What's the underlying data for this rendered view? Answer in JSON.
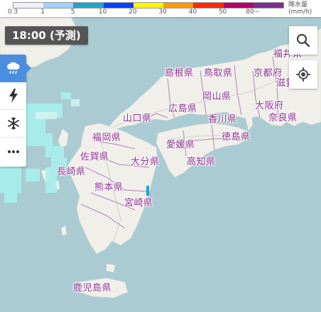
{
  "legend": {
    "unit_label": "降水量",
    "unit": "(mm/h)",
    "ticks": [
      "0.3",
      "1",
      "5",
      "10",
      "20",
      "30",
      "40",
      "50",
      "80~"
    ],
    "colors": [
      "#f2f2ff",
      "#a0d2ff",
      "#21a3c9",
      "#0041ff",
      "#fff500",
      "#ff9900",
      "#ff2800",
      "#b40068",
      "#7a2f8e"
    ]
  },
  "forecast_time": "18:00 (予測)",
  "layers": [
    {
      "name": "rain",
      "icon": "rain-cloud-icon",
      "active": true
    },
    {
      "name": "lightning",
      "icon": "lightning-icon",
      "active": false
    },
    {
      "name": "snow",
      "icon": "snowflake-icon",
      "active": false
    },
    {
      "name": "more",
      "icon": "more-icon",
      "active": false
    }
  ],
  "controls": {
    "search_icon": "search-icon",
    "locate_icon": "current-location-icon"
  },
  "prefectures": {
    "fukui": "福井県",
    "shimane": "島根県",
    "tottori": "鳥取県",
    "kyoto": "京都府",
    "shiga": "滋賀県",
    "okayama": "岡山県",
    "hiroshima": "広島県",
    "osaka": "大阪府",
    "yamaguchi": "山口県",
    "kagawa": "香川県",
    "nara": "奈良県",
    "fukuoka": "福岡県",
    "tokushima": "徳島県",
    "ehime": "愛媛県",
    "saga": "佐賀県",
    "oita": "大分県",
    "kochi": "高知県",
    "nagasaki": "長崎県",
    "kumamoto": "熊本県",
    "miyazaki": "宮崎県",
    "kagoshima": "鹿児島県"
  },
  "colors": {
    "sea": "#aacbd2",
    "land": "#f1efe9",
    "rain_light": "#a7f0ee",
    "border": "#9a6ab3"
  }
}
